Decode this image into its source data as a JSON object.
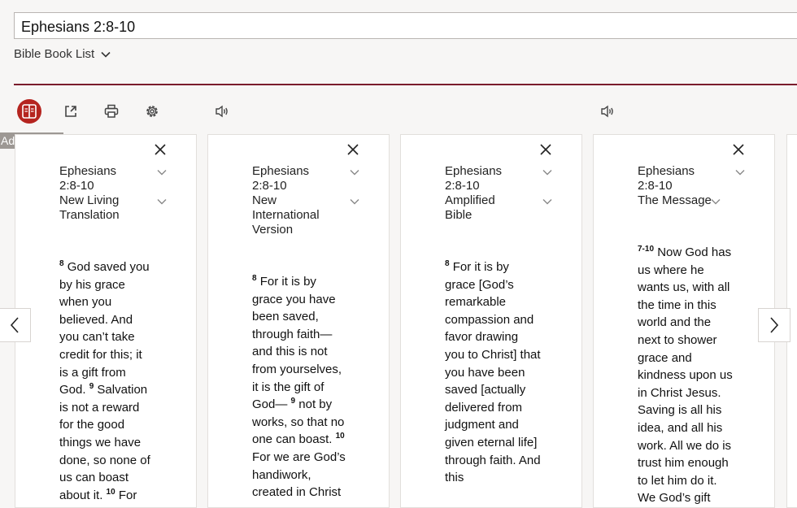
{
  "search": {
    "value": "Ephesians 2:8-10"
  },
  "book_list": {
    "label": "Bible Book List"
  },
  "toolbar": {
    "tooltip": "Add parallel",
    "accent_color": "#b5241f",
    "divider_color": "#7a1c2c"
  },
  "columns": [
    {
      "reference": "Ephesians 2:8-10",
      "version": "New Living Translation",
      "text": [
        {
          "v": "8",
          "t": "God saved you by his grace when you believed. And you can’t take credit for this; it is a gift from God. "
        },
        {
          "v": "9",
          "t": "Salvation is not a reward for the good things we have done, so none of us can boast about it. "
        },
        {
          "v": "10",
          "t": "For"
        }
      ]
    },
    {
      "reference": "Ephesians 2:8-10",
      "version": "New International Version",
      "text": [
        {
          "v": "8",
          "t": "For it is by grace you have been saved, through faith—and this is not from yourselves, it is the gift of God— "
        },
        {
          "v": "9",
          "t": "not by works, so that no one can boast. "
        },
        {
          "v": "10",
          "t": "For we are God’s handiwork, created in Christ"
        }
      ]
    },
    {
      "reference": "Ephesians 2:8-10",
      "version": "Amplified Bible",
      "text": [
        {
          "v": "8",
          "t": "For it is by grace [God’s remarkable compassion and favor drawing you to Christ] that you have been saved [actually delivered from judgment and given eternal life] through faith. And this"
        }
      ]
    },
    {
      "reference": "Ephesians 2:8-10",
      "version": "The Message",
      "text": [
        {
          "v": "7-10",
          "t": "Now God has us where he wants us, with all the time in this world and the next to shower grace and kindness upon us in Christ Jesus. Saving is all his idea, and all his work. All we do is trust him enough to let him do it. We God’s gift"
        }
      ]
    }
  ]
}
